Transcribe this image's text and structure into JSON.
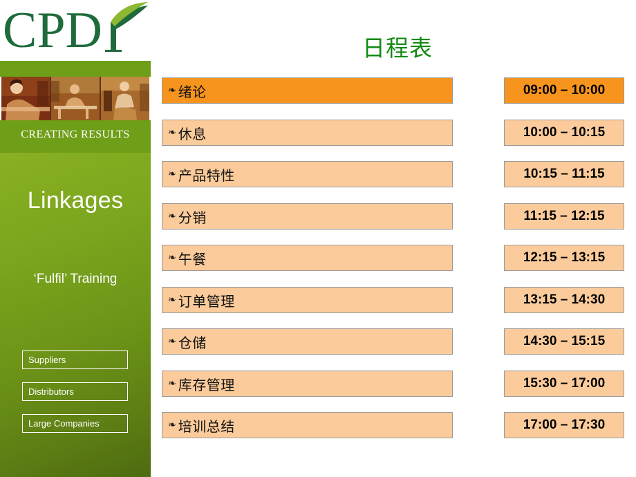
{
  "brand": {
    "logo_text": "CPDI",
    "tagline": "CREATING RESULTS",
    "leaf_icon": "leaf-icon"
  },
  "sidebar": {
    "title": "Linkages",
    "subtitle": "‘Fulfil’ Training",
    "boxes": [
      {
        "label": "Suppliers"
      },
      {
        "label": "Distributors"
      },
      {
        "label": "Large Companies"
      }
    ]
  },
  "main": {
    "title": "日程表",
    "bullet_glyph": "❧",
    "rows": [
      {
        "topic": "绪论",
        "time": "09:00 – 10:00",
        "highlight": true
      },
      {
        "topic": "休息",
        "time": "10:00 – 10:15",
        "highlight": false
      },
      {
        "topic": "产品特性",
        "time": "10:15 – 11:15",
        "highlight": false
      },
      {
        "topic": "分销",
        "time": "11:15 – 12:15",
        "highlight": false
      },
      {
        "topic": "午餐",
        "time": "12:15 – 13:15",
        "highlight": false
      },
      {
        "topic": "订单管理",
        "time": "13:15 – 14:30",
        "highlight": false
      },
      {
        "topic": "仓储",
        "time": "14:30 – 15:15",
        "highlight": false
      },
      {
        "topic": "库存管理",
        "time": "15:30 – 17:00",
        "highlight": false
      },
      {
        "topic": "培训总结",
        "time": "17:00 – 17:30",
        "highlight": false
      }
    ]
  },
  "colors": {
    "title_green": "#128a12",
    "brand_green_dark": "#1f6b3b",
    "brand_green_light": "#8cb833",
    "band_green": "#6f9e18",
    "highlight_orange": "#f7941d",
    "row_peach": "#fbcb9b",
    "row_border": "#9a9a9a"
  }
}
